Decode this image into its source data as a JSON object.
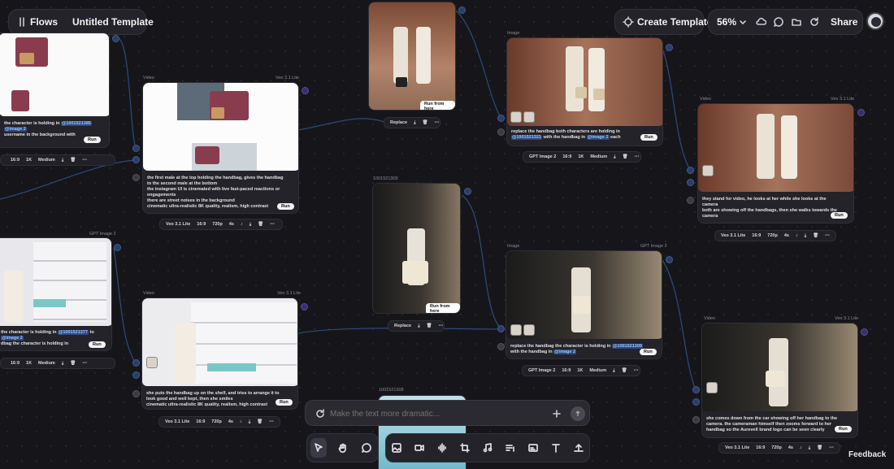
{
  "header": {
    "flows_label": "Flows",
    "template_title": "Untitled Template",
    "create_label": "Create Template",
    "zoom": "56%",
    "share_label": "Share"
  },
  "cards": {
    "video_label": "Video",
    "image_label": "Image",
    "model_veo": "Veo 3.1 Lite",
    "model_gpt": "GPT Image 2",
    "id_a": "1001521309",
    "id_b": "1001521309",
    "c1": "the character is holding in",
    "c1_tag": "@1001521385",
    "c1_tag2": "@image 2",
    "c1_rest": "username in the background with",
    "c2a": "the first male at the top holding the handbag, gives the handbag",
    "c2b": "to the second male at the bottom",
    "c2c": "the instagram UI is cinemated with live fast-paced reactions or",
    "c2d": "engagements",
    "c2e": "there are street noises in the background",
    "c2f": "cinematic ultra-realistic 8K quality, realism, high contrast",
    "c3a": "replace the handbag both characters are holding in",
    "c3_tag": "@1001521321",
    "c3b": "with the handbag in",
    "c3_tag2": "@image 2",
    "c3c": "each",
    "c4a": "they stand for video, he looks at her while she looks at the",
    "c4b": "camera",
    "c4c": "both are showing off the handbags, then she walks towards the",
    "c4d": "camera",
    "c5a": "the character is holding in",
    "c5_tag": "@1001521377",
    "c5b": "to",
    "c5_tag2": "@image 2",
    "c5c": "dbag the character is holding in",
    "c6a": "she puts the handbag up on the shelf, and tries to arrange it to",
    "c6b": "look good and well kept, then she smiles",
    "c6c": "cinematic ultra-realistic 8K quality, realism, high contrast",
    "c7a": "replace the handbag the character is holding in",
    "c7_tag": "@1001521309",
    "c7b": "with the handbag in",
    "c7_tag2": "@image 2",
    "c8a": "she comes down from the car showing off her handbag to the",
    "c8b": "camera. the cameraman himself then zooms forward to her",
    "c8c": "handbag so the Aurevell brand logo can be seen clearly",
    "run": "Run",
    "run_from": "Run from here",
    "replace": "Replace"
  },
  "toolbars": {
    "ratio": "16:9",
    "res_1k": "1K",
    "res_720": "720p",
    "dur": "4s",
    "quality": "Medium"
  },
  "chat": {
    "placeholder": "Make the text more dramatic..."
  },
  "feedback": "Feedback"
}
